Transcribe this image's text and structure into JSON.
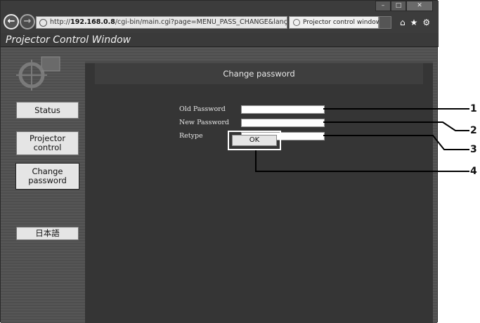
{
  "browser": {
    "url_prefix": "http://",
    "url_host": "192.168.0.8",
    "url_rest": "/cgi-bin/main.cgi?page=MENU_PASS_CHANGE&lanç",
    "url_controls": "⌕ ▾ ≡ ↻ ✕",
    "tab_title": "Projector control window",
    "tab_close": "×",
    "back_glyph": "←",
    "forward_glyph": "→",
    "minimize_glyph": "–",
    "maximize_glyph": "□",
    "close_glyph": "✕",
    "toolbar_glyphs": [
      "⌂",
      "★",
      "⚙"
    ]
  },
  "app": {
    "title": "Projector Control Window"
  },
  "sidebar": {
    "items": [
      {
        "label": "Status"
      },
      {
        "label": "Projector\ncontrol"
      },
      {
        "label": "Change\npassword"
      },
      {
        "label": "日本語"
      }
    ],
    "selected": "Change password"
  },
  "main": {
    "heading": "Change password",
    "fields": [
      {
        "label": "Old Password",
        "value": ""
      },
      {
        "label": "New Password",
        "value": ""
      },
      {
        "label": "Retype",
        "value": ""
      }
    ],
    "ok_label": "OK"
  },
  "callouts": [
    "1",
    "2",
    "3",
    "4"
  ]
}
